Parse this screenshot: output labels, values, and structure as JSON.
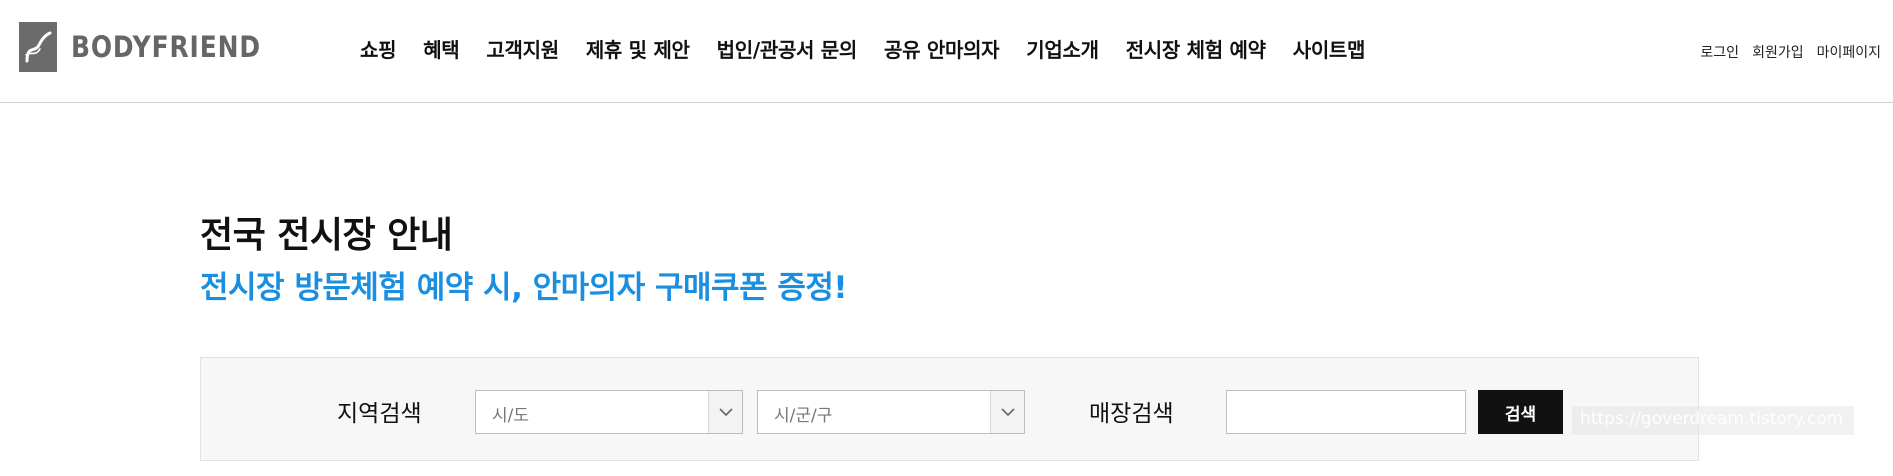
{
  "header": {
    "logo": {
      "icon": "bodyfriend-logo-icon",
      "text": "BODYFRIEND"
    },
    "nav": [
      {
        "label": "쇼핑"
      },
      {
        "label": "혜택"
      },
      {
        "label": "고객지원"
      },
      {
        "label": "제휴 및 제안"
      },
      {
        "label": "법인/관공서 문의"
      },
      {
        "label": "공유 안마의자"
      },
      {
        "label": "기업소개"
      },
      {
        "label": "전시장 체험 예약"
      },
      {
        "label": "사이트맵"
      }
    ],
    "util": [
      {
        "label": "로그인"
      },
      {
        "label": "회원가입"
      },
      {
        "label": "마이페이지"
      }
    ]
  },
  "main": {
    "title": "전국 전시장 안내",
    "subtitle": "전시장 방문체험 예약 시, 안마의자 구매쿠폰 증정!",
    "subtitle_color": "#1a8fe0",
    "search": {
      "region_label": "지역검색",
      "city_select": {
        "selected": "시/도",
        "icon": "chevron-down-icon"
      },
      "district_select": {
        "selected": "시/군/구",
        "icon": "chevron-down-icon"
      },
      "store_label": "매장검색",
      "store_input": {
        "value": "",
        "placeholder": ""
      },
      "search_button_label": "검색"
    }
  },
  "watermark": {
    "text": "https://goverdream.tistory.com"
  }
}
